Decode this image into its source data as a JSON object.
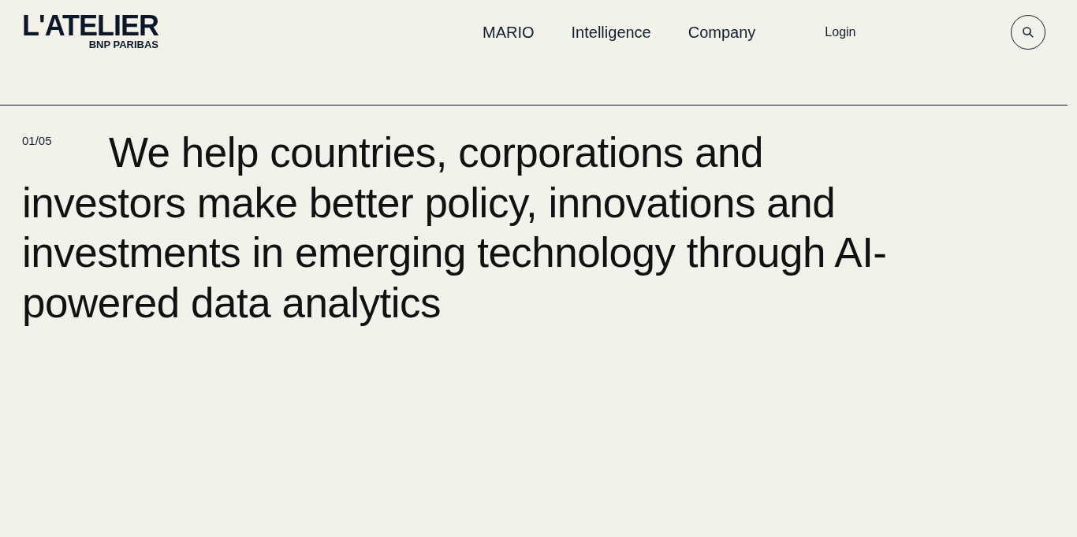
{
  "logo": {
    "wordmark": "L'ATELIER",
    "subtitle": "BNP PARIBAS"
  },
  "nav": {
    "links": [
      "MARIO",
      "Intelligence",
      "Company"
    ],
    "login": "Login"
  },
  "hero": {
    "counter": "01/05",
    "headline_lines": [
      "We help countries, corporations and",
      "investors make better policy, innovations and",
      "investments in emerging technology through AI-",
      "powered data analytics"
    ]
  }
}
